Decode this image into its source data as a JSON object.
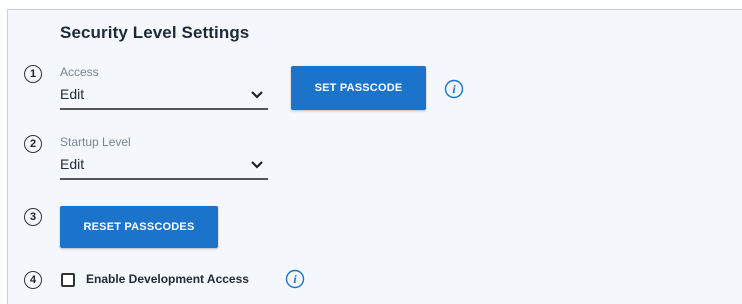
{
  "section_title": "Security Level Settings",
  "steps": [
    "1",
    "2",
    "3",
    "4"
  ],
  "access": {
    "label": "Access",
    "value": "Edit"
  },
  "set_passcode_label": "SET PASSCODE",
  "startup_level": {
    "label": "Startup Level",
    "value": "Edit"
  },
  "reset_passcodes_label": "RESET PASSCODES",
  "development_access": {
    "label": "Enable Development Access",
    "checked": false
  },
  "info_icon_glyph": "i",
  "colors": {
    "accent": "#1b74c9",
    "panel_bg": "#f4f8fc"
  }
}
